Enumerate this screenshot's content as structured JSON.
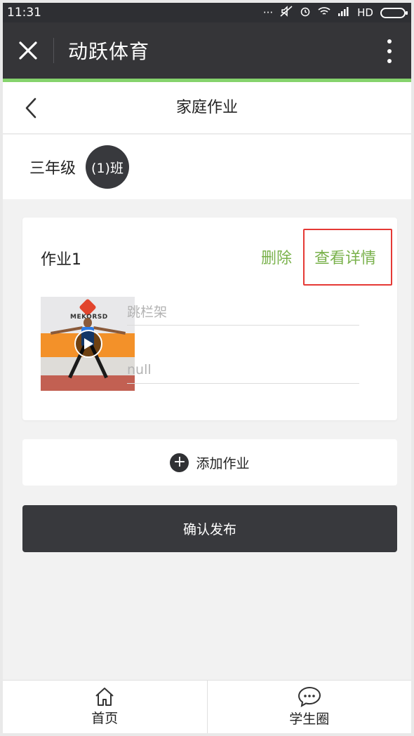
{
  "status_bar": {
    "time": "11:31",
    "network": "HD",
    "icons": [
      "signal-dots-icon",
      "mute-icon",
      "alarm-icon",
      "wifi-icon",
      "cell-signal-icon",
      "battery-icon"
    ]
  },
  "titlebar": {
    "title": "动跃体育",
    "close_icon": "close-icon",
    "more_icon": "more-vertical-icon"
  },
  "page": {
    "title": "家庭作业",
    "back_icon": "chevron-left-icon"
  },
  "class_selector": {
    "grade": "三年级",
    "class_name": "(1)班"
  },
  "homework": {
    "title": "作业1",
    "delete_label": "删除",
    "detail_label": "查看详情",
    "video_brand": "MEKORSD",
    "exercise_name": "跳栏架",
    "note": "null"
  },
  "actions": {
    "add_label": "添加作业",
    "confirm_label": "确认发布"
  },
  "bottom_nav": {
    "items": [
      {
        "label": "首页",
        "icon": "home-icon"
      },
      {
        "label": "学生圈",
        "icon": "chat-bubble-icon"
      }
    ]
  },
  "colors": {
    "accent_green": "#79b14b",
    "progress_green": "#85d36c",
    "dark": "#38393d",
    "highlight_red": "#e53935"
  }
}
